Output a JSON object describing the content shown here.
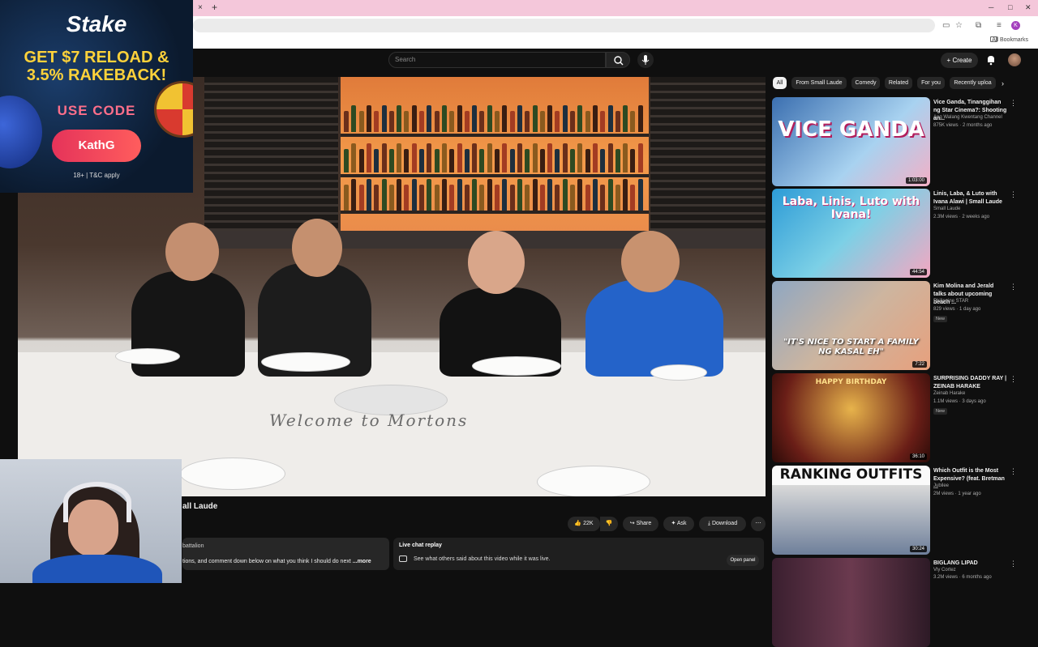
{
  "browser": {
    "tab_close": "×",
    "tab_new": "+",
    "bookmarks_all": "All Bookmarks",
    "profile_letter": "K"
  },
  "header": {
    "search_placeholder": "Search",
    "create_label": "Create"
  },
  "ad": {
    "brand": "Stake",
    "line1": "GET $7 RELOAD &",
    "line2": "3.5% RAKEBACK!",
    "code_label": "USE CODE",
    "code": "KathG",
    "terms": "18+ | T&C apply"
  },
  "video": {
    "table_text": "Welcome to Mortons",
    "title_fragment": "all Laude"
  },
  "actions": {
    "likes": "22K",
    "share": "Share",
    "ask": "Ask",
    "download": "Download"
  },
  "description": {
    "channel_fragment": "battalion",
    "text": "tions, and comment down below on what you think I should do next",
    "more": "...more"
  },
  "chat": {
    "title": "Live chat replay",
    "subtitle": "See what others said about this video while it was live.",
    "open": "Open panel"
  },
  "chips": [
    "All",
    "From Small Laude",
    "Comedy",
    "Related",
    "For you",
    "Recently uploa"
  ],
  "recommendations": [
    {
      "title": "Vice Ganda, Tinanggihan ng Star Cinema?: Shooting an...",
      "channel": "Ang Walang Kwentang Channel",
      "meta": "875K views · 2 months ago",
      "duration": "1:03:00",
      "thumb_text": "VICE GANDA",
      "badge": ""
    },
    {
      "title": "Linis, Laba, & Luto with Ivana Alawi | Small Laude",
      "channel": "Small Laude",
      "meta": "2.3M views · 2 weeks ago",
      "duration": "44:54",
      "thumb_text": "Laba, Linis, Luto with Ivana!",
      "badge": ""
    },
    {
      "title": "Kim Molina and Jerald talks about upcoming beach ...",
      "channel": "Philippine STAR",
      "meta": "829 views · 1 day ago",
      "duration": "7:22",
      "thumb_text": "\"IT'S NICE TO START A FAMILY NG KASAL EH\"",
      "badge": "New"
    },
    {
      "title": "SURPRISING DADDY RAY | ZEINAB HARAKE",
      "channel": "Zeinab Harake",
      "meta": "1.1M views · 3 days ago",
      "duration": "36:10",
      "thumb_text": "HAPPY BIRTHDAY",
      "badge": "New"
    },
    {
      "title": "Which Outfit is the Most Expensive? (feat. Bretman ...",
      "channel": "Jubilee",
      "meta": "2M views · 1 year ago",
      "duration": "30:24",
      "thumb_text": "RANKING OUTFITS",
      "badge": ""
    },
    {
      "title": "BIGLANG LIPAD",
      "channel": "Vly Cortez",
      "meta": "3.2M views · 6 months ago",
      "duration": "",
      "thumb_text": "",
      "badge": ""
    }
  ],
  "colors": {
    "yt_bg": "#0f0f0f",
    "tab_pink": "#f4c7da",
    "ad_yellow": "#ffd23a",
    "ad_red": "#e5335a"
  }
}
